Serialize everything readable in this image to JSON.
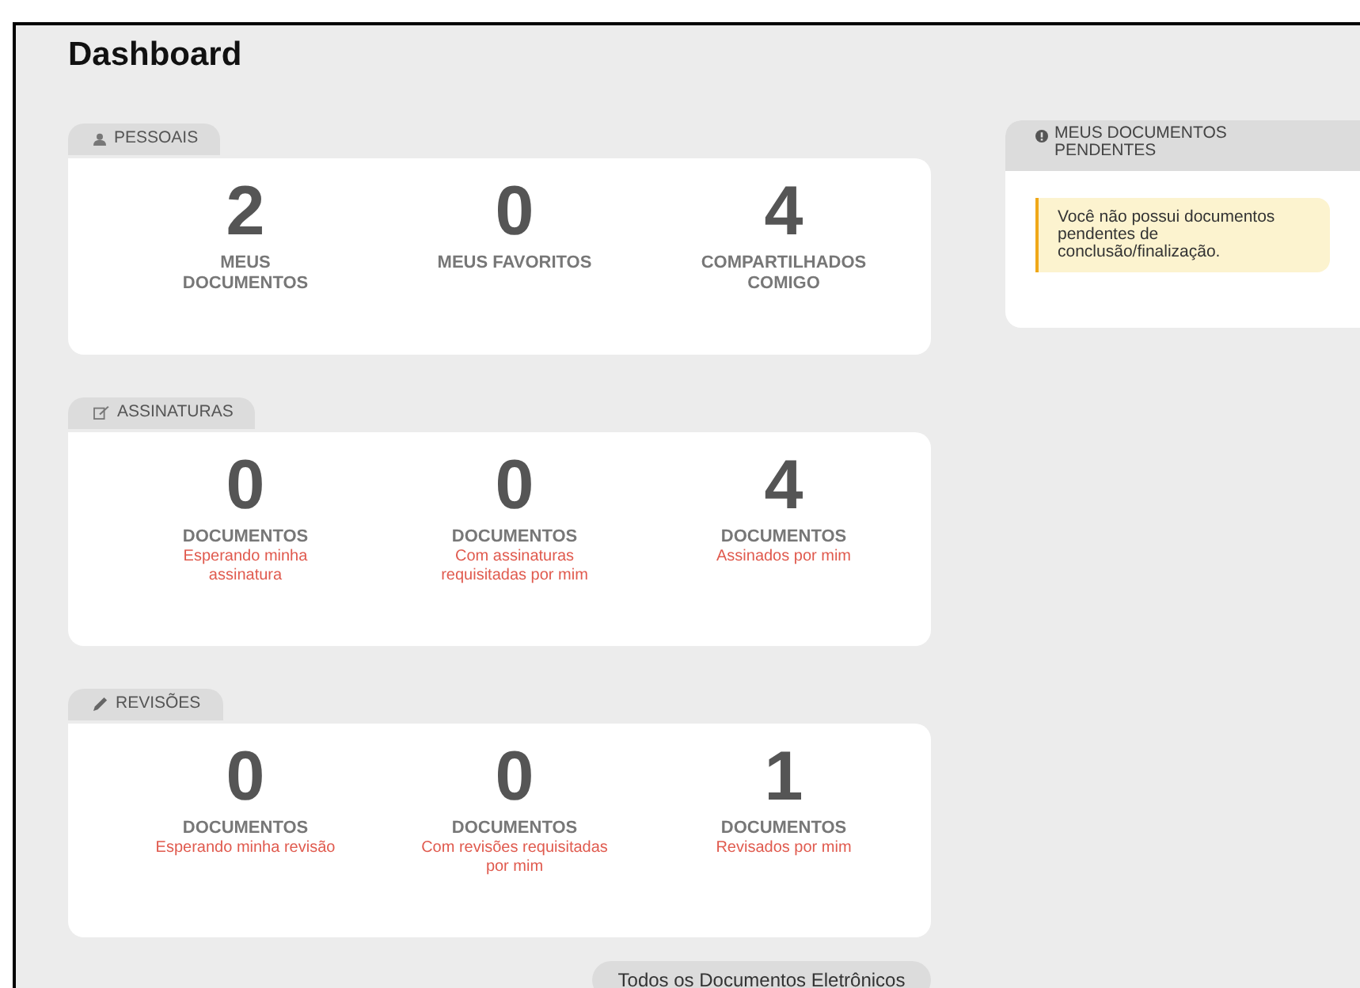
{
  "title": "Dashboard",
  "sections": [
    {
      "label": "PESSOAIS",
      "stats": [
        {
          "value": "2",
          "label": "MEUS DOCUMENTOS"
        },
        {
          "value": "0",
          "label": "MEUS FAVORITOS"
        },
        {
          "value": "4",
          "label": "COMPARTILHADOS COMIGO"
        }
      ]
    },
    {
      "label": "ASSINATURAS",
      "stats": [
        {
          "value": "0",
          "label": "DOCUMENTOS",
          "sub": "Esperando minha assinatura"
        },
        {
          "value": "0",
          "label": "DOCUMENTOS",
          "sub": "Com assinaturas requisitadas por mim"
        },
        {
          "value": "4",
          "label": "DOCUMENTOS",
          "sub": "Assinados por mim"
        }
      ]
    },
    {
      "label": "REVISÕES",
      "stats": [
        {
          "value": "0",
          "label": "DOCUMENTOS",
          "sub": "Esperando minha revisão"
        },
        {
          "value": "0",
          "label": "DOCUMENTOS",
          "sub": "Com revisões requisitadas por mim"
        },
        {
          "value": "1",
          "label": "DOCUMENTOS",
          "sub": "Revisados por mim"
        }
      ]
    }
  ],
  "all_documents_button": "Todos os Documentos Eletrônicos",
  "pending_panel": {
    "title": "MEUS DOCUMENTOS PENDENTES",
    "message": "Você não possui documentos pendentes de conclusão/finalização."
  }
}
